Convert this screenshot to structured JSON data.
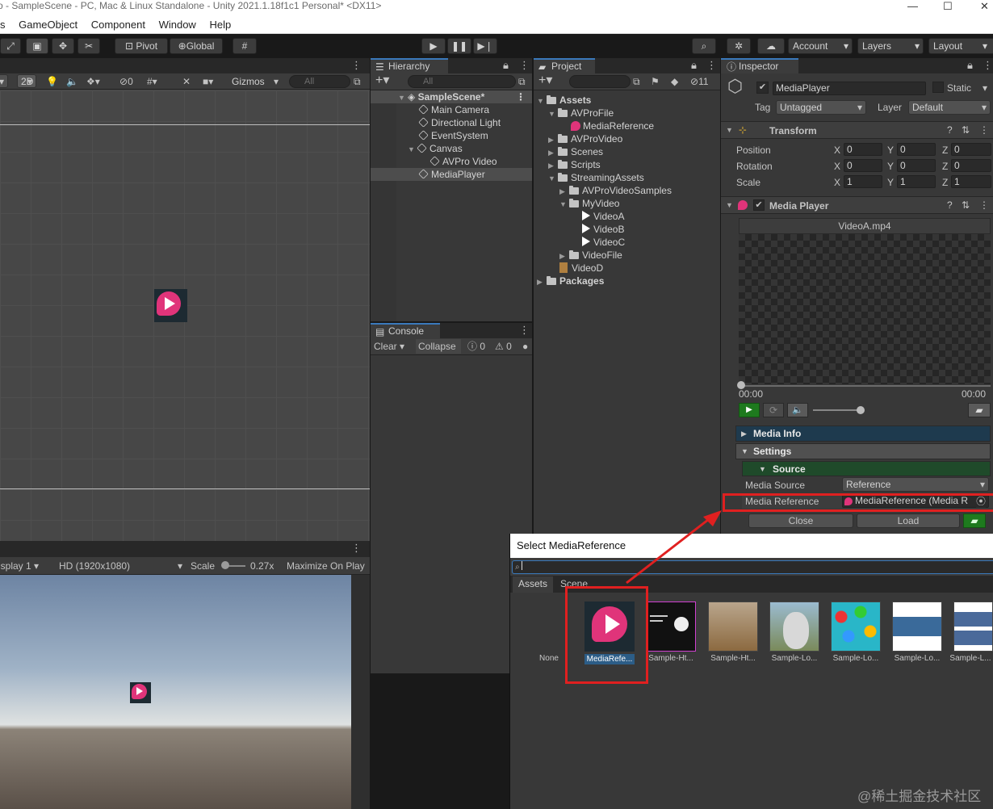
{
  "window": {
    "title": "o - SampleScene - PC, Mac & Linux Standalone - Unity 2021.1.18f1c1 Personal* <DX11>"
  },
  "menu": [
    "s",
    "GameObject",
    "Component",
    "Window",
    "Help"
  ],
  "toolbar": {
    "pivot": "Pivot",
    "global": "Global",
    "account": "Account",
    "layers": "Layers",
    "layout": "Layout"
  },
  "scene": {
    "mode_2d": "2D",
    "hidden_count": "0",
    "gizmos": "Gizmos",
    "search_placeholder": "All"
  },
  "game": {
    "display": "isplay 1",
    "resolution": "HD (1920x1080)",
    "scale_label": "Scale",
    "scale_value": "0.27x",
    "maximize": "Maximize On Play"
  },
  "hierarchy": {
    "tab": "Hierarchy",
    "search_placeholder": "All",
    "scene": "SampleScene*",
    "items": [
      "Main Camera",
      "Directional Light",
      "EventSystem",
      "Canvas",
      "AVPro Video",
      "MediaPlayer"
    ]
  },
  "project": {
    "tab": "Project",
    "count": "11",
    "tree": [
      "Assets",
      "AVProFile",
      "MediaReference",
      "AVProVideo",
      "Scenes",
      "Scripts",
      "StreamingAssets",
      "AVProVideoSamples",
      "MyVideo",
      "VideoA",
      "VideoB",
      "VideoC",
      "VideoFile",
      "VideoD",
      "Packages"
    ]
  },
  "console": {
    "tab": "Console",
    "clear": "Clear",
    "collapse": "Collapse",
    "errors": "0",
    "warnings": "0"
  },
  "inspector": {
    "tab": "Inspector",
    "object_name": "MediaPlayer",
    "static": "Static",
    "tag_label": "Tag",
    "tag": "Untagged",
    "layer_label": "Layer",
    "layer": "Default",
    "transform": {
      "title": "Transform",
      "rows": [
        {
          "label": "Position",
          "x": "0",
          "y": "0",
          "z": "0"
        },
        {
          "label": "Rotation",
          "x": "0",
          "y": "0",
          "z": "0"
        },
        {
          "label": "Scale",
          "x": "1",
          "y": "1",
          "z": "1"
        }
      ],
      "axes": [
        "X",
        "Y",
        "Z"
      ]
    },
    "media_player": {
      "title": "Media Player",
      "preview_file": "VideoA.mp4",
      "time_start": "00:00",
      "time_end": "00:00",
      "progress": 0
    },
    "media_info": "Media Info",
    "settings": "Settings",
    "source": "Source",
    "media_source_label": "Media Source",
    "media_source": "Reference",
    "media_reference_label": "Media Reference",
    "media_reference": "MediaReference (Media R",
    "close": "Close",
    "load": "Load"
  },
  "picker": {
    "title": "Select MediaReference",
    "tabs": [
      "Assets",
      "Scene"
    ],
    "none": "None",
    "items": [
      "MediaRefe...",
      "Sample-Ht...",
      "Sample-Ht...",
      "Sample-Lo...",
      "Sample-Lo...",
      "Sample-Lo...",
      "Sample-L..."
    ]
  },
  "watermark": "@稀土掘金技术社区",
  "colors": {
    "highlight": "#e02020",
    "accent": "#e0347a",
    "selection": "#2c5d87"
  }
}
